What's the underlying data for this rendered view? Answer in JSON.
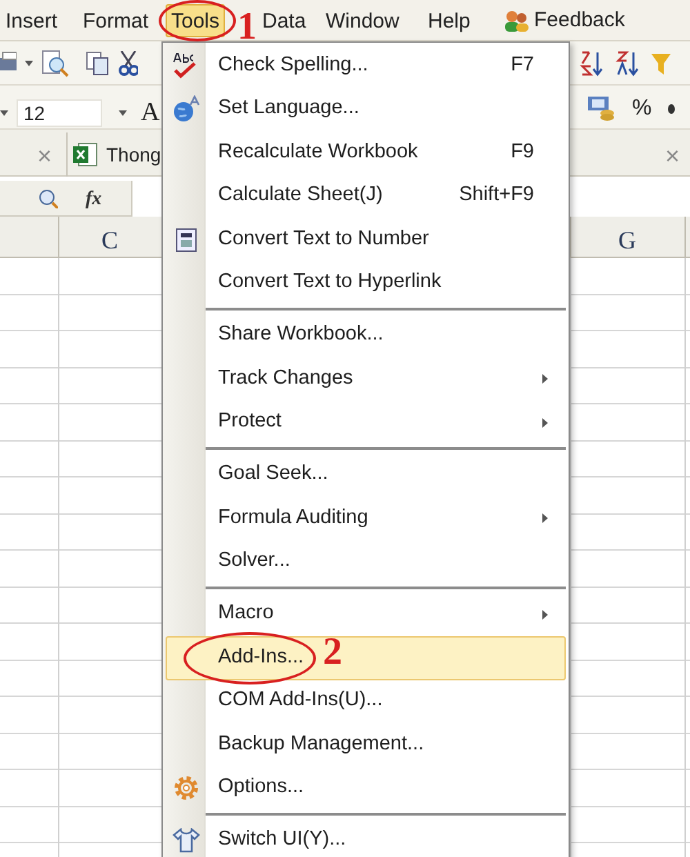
{
  "menu_bar": [
    {
      "label": "Insert",
      "selected": false
    },
    {
      "label": "Format",
      "selected": false
    },
    {
      "label": "Tools",
      "selected": true
    },
    {
      "label": "Data",
      "selected": false
    },
    {
      "label": "Window",
      "selected": false
    },
    {
      "label": "Help",
      "selected": false
    },
    {
      "label": "Feedback",
      "selected": false
    }
  ],
  "toolbar": {
    "font_size": "12",
    "font_color_letter": "A",
    "percent": "%"
  },
  "tab_bar": {
    "left_close": "×",
    "tab_label": "Thong",
    "right_close": "×"
  },
  "formula_bar": {
    "function_label": "fx"
  },
  "columns": [
    "C",
    "G"
  ],
  "tools_menu": [
    {
      "kind": "item",
      "label": "Check Spelling...",
      "shortcut": "F7",
      "submenu": false,
      "selected": false
    },
    {
      "kind": "item",
      "label": "Set Language...",
      "submenu": false,
      "selected": false
    },
    {
      "kind": "item",
      "label": "Recalculate Workbook",
      "shortcut": "F9",
      "submenu": false,
      "selected": false
    },
    {
      "kind": "item",
      "label": "Calculate Sheet(J)",
      "shortcut": "Shift+F9",
      "submenu": false,
      "selected": false
    },
    {
      "kind": "item",
      "label": "Convert Text to Number",
      "submenu": false,
      "selected": false
    },
    {
      "kind": "item",
      "label": "Convert Text to Hyperlink",
      "submenu": false,
      "selected": false
    },
    {
      "kind": "separator"
    },
    {
      "kind": "item",
      "label": "Share Workbook...",
      "submenu": false,
      "selected": false
    },
    {
      "kind": "item",
      "label": "Track Changes",
      "submenu": true,
      "selected": false
    },
    {
      "kind": "item",
      "label": "Protect",
      "submenu": true,
      "selected": false
    },
    {
      "kind": "separator"
    },
    {
      "kind": "item",
      "label": "Goal Seek...",
      "submenu": false,
      "selected": false
    },
    {
      "kind": "item",
      "label": "Formula Auditing",
      "submenu": true,
      "selected": false
    },
    {
      "kind": "item",
      "label": "Solver...",
      "submenu": false,
      "selected": false
    },
    {
      "kind": "separator"
    },
    {
      "kind": "item",
      "label": "Macro",
      "submenu": true,
      "selected": false
    },
    {
      "kind": "item",
      "label": "Add-Ins...",
      "submenu": false,
      "selected": true
    },
    {
      "kind": "item",
      "label": "COM Add-Ins(U)...",
      "submenu": false,
      "selected": false
    },
    {
      "kind": "item",
      "label": "Backup Management...",
      "submenu": false,
      "selected": false
    },
    {
      "kind": "item",
      "label": "Options...",
      "submenu": false,
      "selected": false
    },
    {
      "kind": "separator"
    },
    {
      "kind": "item",
      "label": "Switch UI(Y)...",
      "submenu": false,
      "selected": false
    }
  ],
  "annotations": [
    {
      "label": "1"
    },
    {
      "label": "2"
    }
  ]
}
